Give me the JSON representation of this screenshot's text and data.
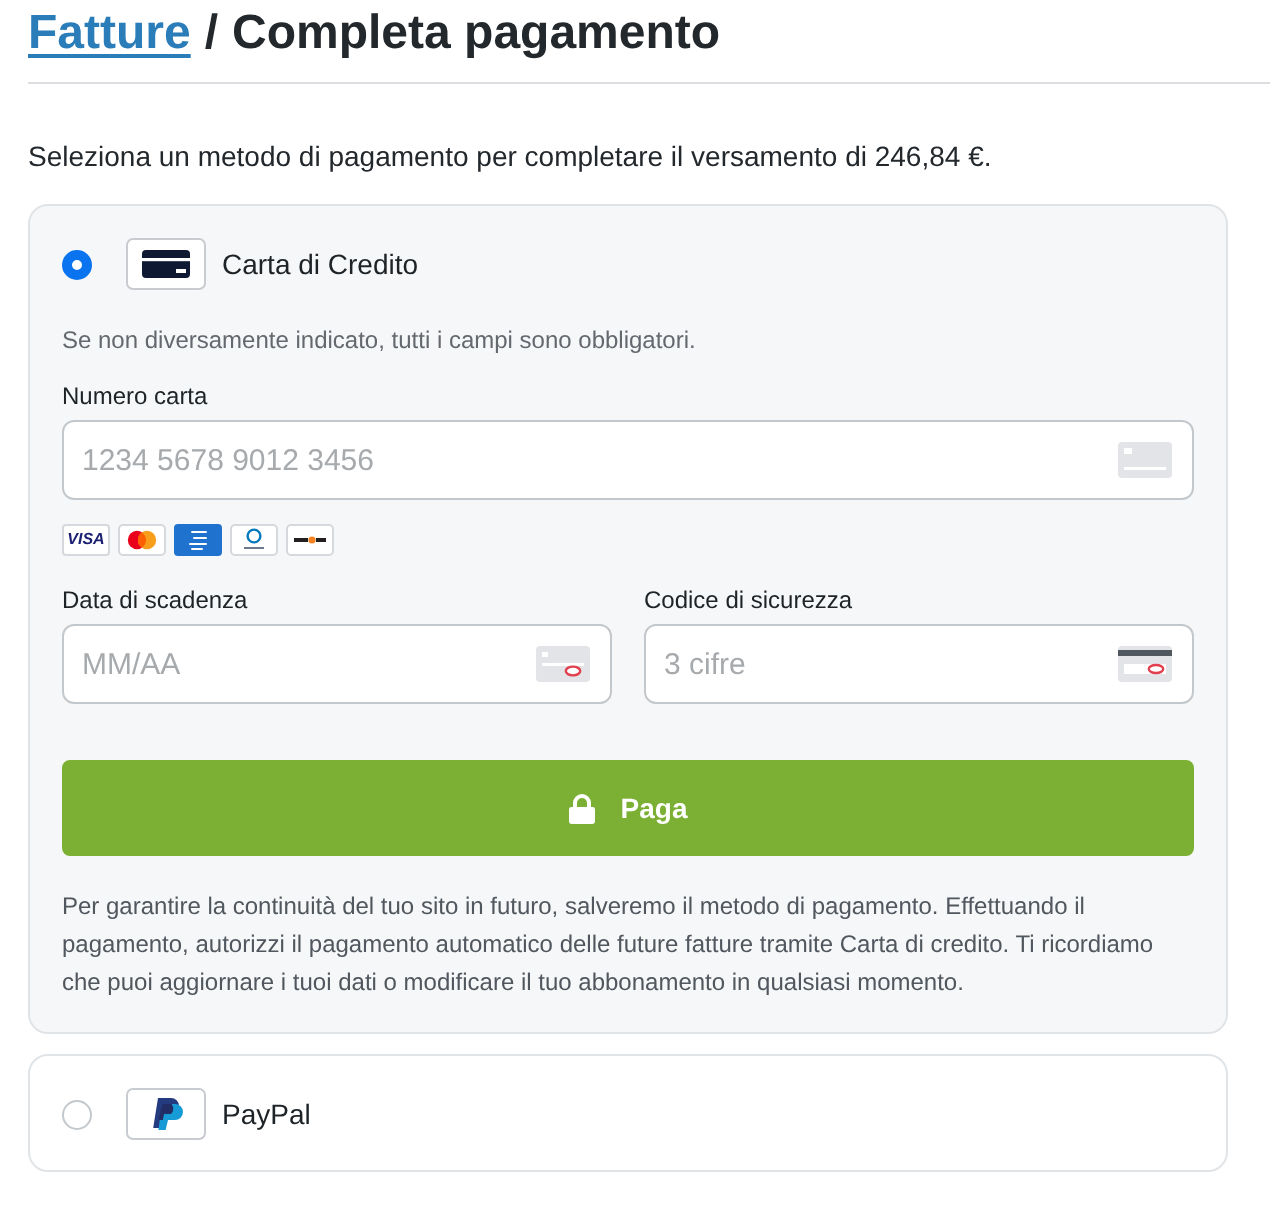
{
  "header": {
    "breadcrumb_link": "Fatture",
    "separator": "/",
    "title": "Completa pagamento"
  },
  "intro": "Seleziona un metodo di pagamento per completare il versamento di 246,84 €.",
  "payment_methods": [
    {
      "kind": "card",
      "label": "Carta di Credito",
      "selected": true,
      "form": {
        "required_note": "Se non diversamente indicato, tutti i campi sono obbligatori.",
        "number_field": {
          "kind": "card_number",
          "label": "Numero carta",
          "placeholder": "1234 5678 9012 3456"
        },
        "accepted_cards": [
          {
            "kind": "visa",
            "label": "VISA"
          },
          {
            "kind": "mastercard"
          },
          {
            "kind": "amex"
          },
          {
            "kind": "diners"
          },
          {
            "kind": "discover"
          }
        ],
        "split_fields": [
          {
            "kind": "expiry",
            "label": "Data di scadenza",
            "placeholder": "MM/AA"
          },
          {
            "kind": "cvc",
            "label": "Codice di sicurezza",
            "placeholder": "3 cifre"
          }
        ],
        "pay_button": "Paga",
        "notice": "Per garantire la continuità del tuo sito in futuro, salveremo il metodo di pagamento. Effettuando il pagamento, autorizzi il pagamento automatico delle future fatture tramite Carta di credito. Ti ricordiamo che puoi aggiornare i tuoi dati o modificare il tuo abbonamento in qualsiasi momento."
      }
    },
    {
      "kind": "paypal",
      "label": "PayPal",
      "selected": false
    }
  ]
}
